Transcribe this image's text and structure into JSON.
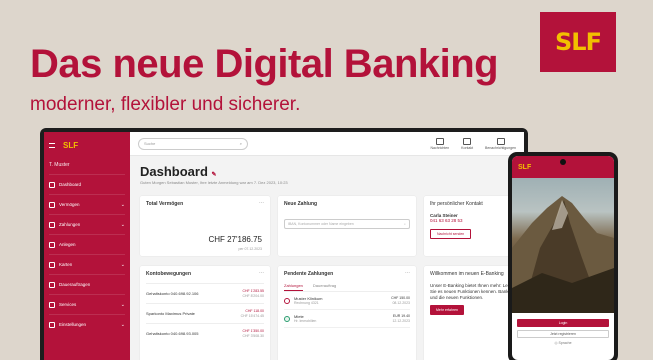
{
  "brand": {
    "logo_text": "SLF",
    "color_primary": "#b3123a",
    "color_logo_text": "#f2c000"
  },
  "hero": {
    "headline": "Das neue Digital Banking",
    "subline": "moderner, flexibler und sicherer."
  },
  "app": {
    "sidebar": {
      "logo": "SLF",
      "user": "T. Muster",
      "items": [
        {
          "label": "Dashboard",
          "icon": "grid-icon",
          "expandable": false
        },
        {
          "label": "Vermögen",
          "icon": "chart-icon",
          "expandable": true
        },
        {
          "label": "Zahlungen",
          "icon": "transfer-icon",
          "expandable": true
        },
        {
          "label": "Anlegen",
          "icon": "growth-icon",
          "expandable": false
        },
        {
          "label": "Karten",
          "icon": "card-icon",
          "expandable": true
        },
        {
          "label": "Dauerauftragen",
          "icon": "repeat-icon",
          "expandable": false
        },
        {
          "label": "Services",
          "icon": "service-icon",
          "expandable": true
        },
        {
          "label": "Einstellungen",
          "icon": "gear-icon",
          "expandable": true
        }
      ]
    },
    "topbar": {
      "search_placeholder": "Suche",
      "buttons": [
        {
          "label": "Nachrichten",
          "icon": "mail-icon"
        },
        {
          "label": "Kontakt",
          "icon": "location-icon"
        },
        {
          "label": "Benachrichtigungen",
          "icon": "bell-icon"
        }
      ]
    },
    "dashboard": {
      "title": "Dashboard",
      "subtitle": "Guten Morgen Sebastian Muster, Ihre letzte Anmeldung war am 7. Dez 2023, 10:23",
      "wealth": {
        "title": "Total Vermögen",
        "amount": "CHF 27'186.75",
        "date": "per 07.12.2023"
      },
      "new_payment": {
        "title": "Neue Zahlung",
        "placeholder": "IBAN, Kontonummer oder Name eingeben"
      },
      "advisor": {
        "title": "Ihr persönlicher Kontakt",
        "name": "Carla Steiner",
        "phone": "041 63 63 28 53",
        "button": "Nachricht senden"
      },
      "accounts": {
        "title": "Kontobewegungen",
        "rows": [
          {
            "name": "Gehaltskonto 040.698.92.106",
            "amount": "CHF 1'283.55",
            "sub": "CHF 8'204.00"
          },
          {
            "name": "Sparkonto Maximus Private",
            "amount": "CHF 118.00",
            "sub": "CHF 15'474.45"
          },
          {
            "name": "Gehaltskonto 040.698.93.005",
            "amount": "CHF 1'350.00",
            "sub": "CHF 3'508.30"
          }
        ]
      },
      "payments": {
        "title": "Pendente Zahlungen",
        "tabs": [
          "Zahlungen",
          "Dauerauftrag"
        ],
        "rows": [
          {
            "name": "Muster Klinikum",
            "ref": "Rechnung 4321",
            "amount": "CHF 150.00",
            "date": "08.12.2023"
          },
          {
            "name": "Miete",
            "ref": "Hr. Immobilien",
            "amount": "EUR 19.40",
            "date": "12.12.2023"
          }
        ]
      },
      "promo": {
        "title": "Willkommen im neuen E-Banking",
        "text": "Unser E-Banking bietet Ihnen mehr: Lernen Sie es neuen Funktionen kennen. Banking und die neuen Funktionen.",
        "button": "Mehr erfahren"
      }
    },
    "mobile": {
      "logo": "SLF",
      "login_button": "Login",
      "secondary_button": "Jetzt registrieren",
      "footer_label": "Sprache"
    }
  }
}
